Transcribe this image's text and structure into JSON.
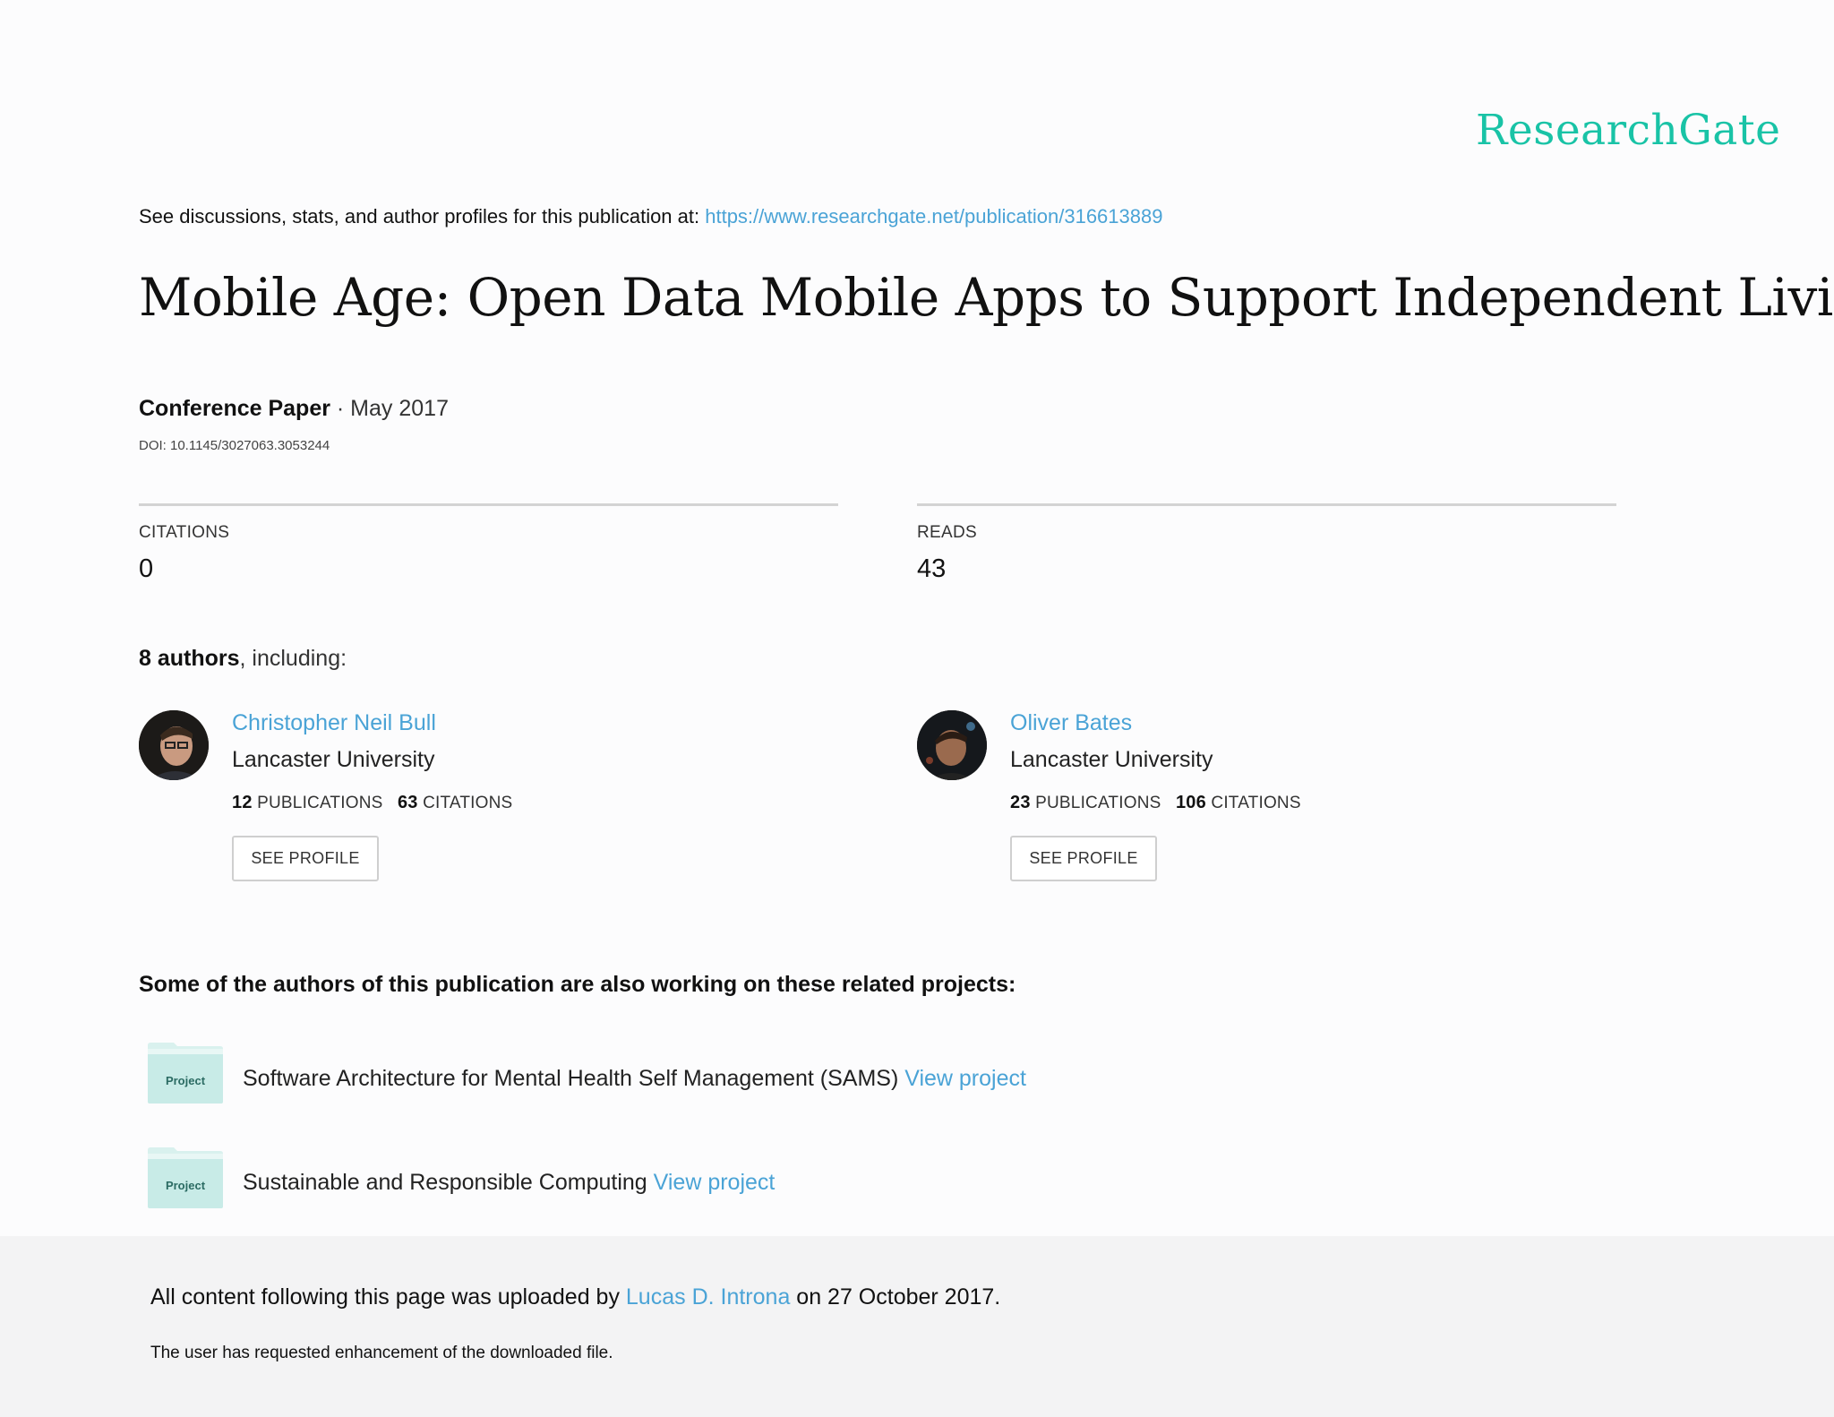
{
  "brand": {
    "logo": "ResearchGate"
  },
  "header": {
    "see_text": "See discussions, stats, and author profiles for this publication at: ",
    "url": "https://www.researchgate.net/publication/316613889"
  },
  "publication": {
    "title": "Mobile Age: Open Data Mobile Apps to Support Independent Living",
    "type": "Conference Paper",
    "date_sep": " · May 2017",
    "doi": "DOI: 10.1145/3027063.3053244"
  },
  "stats": {
    "citations_label": "CITATIONS",
    "citations_value": "0",
    "reads_label": "READS",
    "reads_value": "43"
  },
  "authors": {
    "count_bold": "8 authors",
    "suffix": ", including:",
    "list": [
      {
        "name": "Christopher Neil Bull",
        "affiliation": "Lancaster University",
        "publications": "12",
        "publications_label": "PUBLICATIONS",
        "citations": "63",
        "citations_label": "CITATIONS",
        "button": "SEE PROFILE"
      },
      {
        "name": "Oliver Bates",
        "affiliation": "Lancaster University",
        "publications": "23",
        "publications_label": "PUBLICATIONS",
        "citations": "106",
        "citations_label": "CITATIONS",
        "button": "SEE PROFILE"
      }
    ]
  },
  "projects": {
    "heading": "Some of the authors of this publication are also working on these related projects:",
    "icon_label": "Project",
    "items": [
      {
        "title": "Software Architecture for Mental Health Self Management (SAMS) ",
        "link": "View project"
      },
      {
        "title": "Sustainable and Responsible Computing ",
        "link": "View project"
      }
    ]
  },
  "footer": {
    "uploaded_prefix": "All content following this page was uploaded by ",
    "uploader": "Lucas D. Introna",
    "uploaded_suffix": " on 27 October 2017.",
    "request_text": "The user has requested enhancement of the downloaded file."
  },
  "colors": {
    "brand": "#19c3a6",
    "link": "#4aa3d6",
    "project_icon": "#c8ebe7"
  }
}
